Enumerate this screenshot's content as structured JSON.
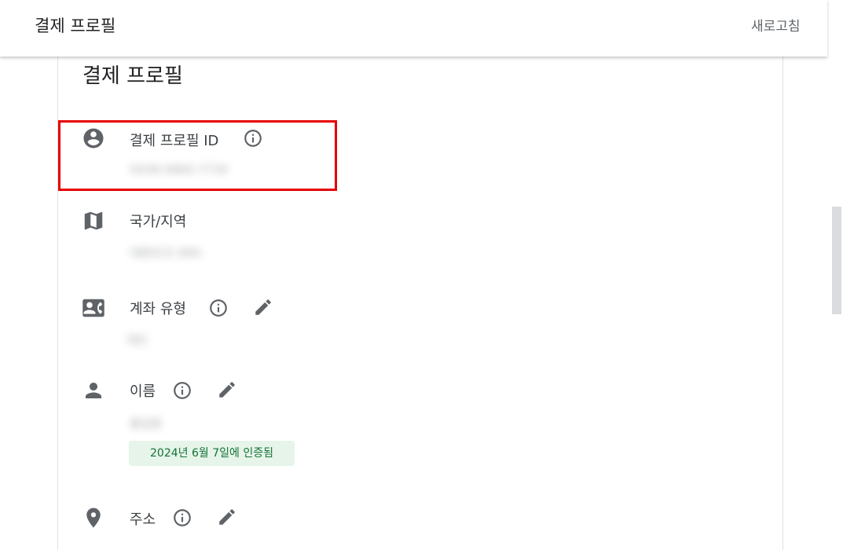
{
  "header": {
    "title": "결제 프로필",
    "refresh_label": "새로고침"
  },
  "card": {
    "title": "결제 프로필"
  },
  "rows": {
    "profile_id": {
      "label": "결제 프로필 ID",
      "value": "5938-0860-7730",
      "icon": "account-circle-icon"
    },
    "country": {
      "label": "국가/지역",
      "value": "대한민국 (KR)",
      "icon": "map-icon"
    },
    "account_type": {
      "label": "계좌 유형",
      "value": "개인",
      "icon": "contact-card-icon"
    },
    "name": {
      "label": "이름",
      "value": "홍길동",
      "icon": "person-icon",
      "verified_badge": "2024년 6월 7일에 인증됨"
    },
    "address": {
      "label": "주소",
      "icon": "location-pin-icon"
    }
  },
  "colors": {
    "highlight": "#e60000",
    "badge_bg": "#e6f4ea",
    "badge_text": "#137333",
    "icon": "#5f6368"
  }
}
